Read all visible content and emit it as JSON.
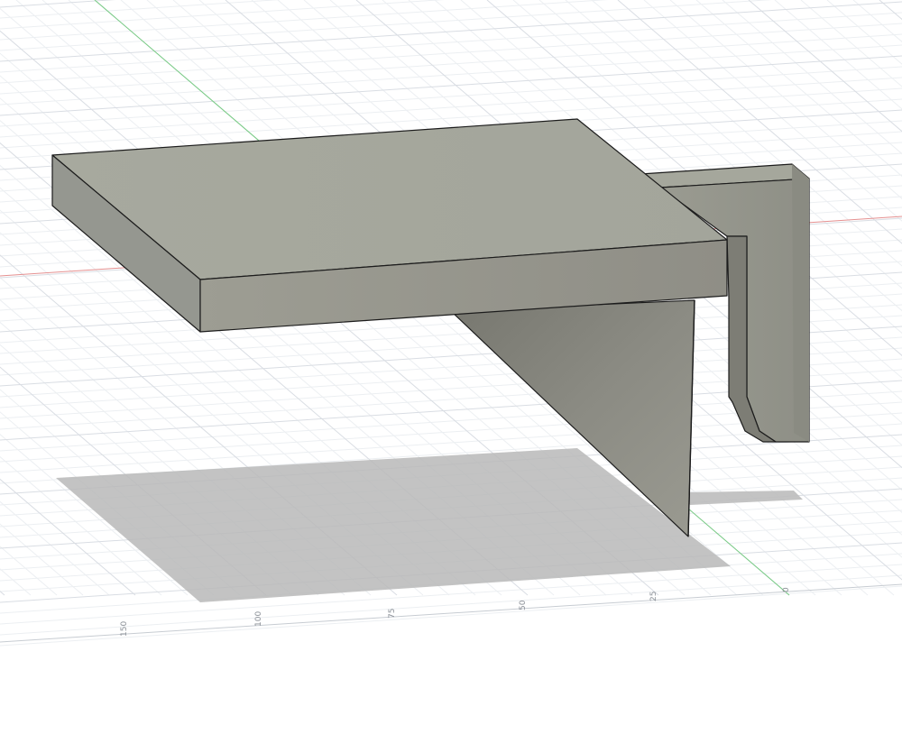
{
  "viewport": {
    "background": "#ffffff",
    "grid_color": "#d9dde3",
    "grid_minor_color": "#eceff2",
    "x_axis_color": "#e27d7d",
    "y_axis_color": "#72c97d"
  },
  "ruler": {
    "ticks": [
      "150",
      "100",
      "75",
      "50",
      "25",
      "0"
    ]
  },
  "model": {
    "color": "#9e9f95",
    "edge_color": "#1c1c1c",
    "shadow_color": "#b3b3b3"
  }
}
